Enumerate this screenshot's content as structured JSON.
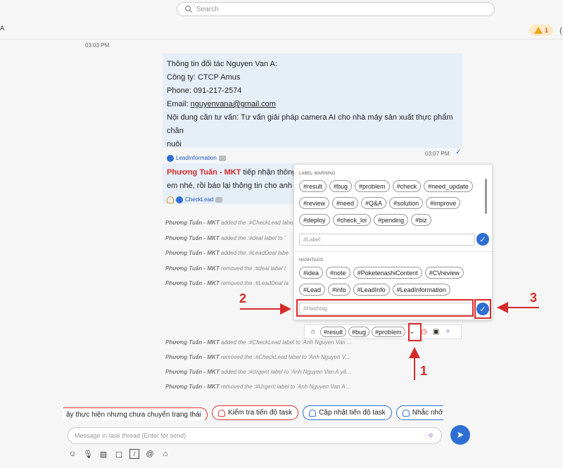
{
  "search": {
    "placeholder": "Search"
  },
  "header": {
    "left_letter": "A",
    "warning_count": "1",
    "right_glyph": "("
  },
  "messages": {
    "time1": "03:03 PM",
    "lead": {
      "line1": "Thông tin đối tác Nguyen Van A:",
      "line2": "Công ty: CTCP Amus",
      "line3": "Phone: 091-217-2574",
      "email_prefix": "Email: ",
      "email": "nguyenvana@gmail.com",
      "line5": "Nội dung cần tư vấn: Tư vấn giải pháp camera AI cho nhà máy sản xuất thực phẩm chăn",
      "line6": "nuôi",
      "tag": "LeadInformation"
    },
    "time2": "03:07 PM",
    "reply": {
      "name": "Phương Tuấn - MKT",
      "text1": " tiếp nhận thông",
      "text2": "em nhé, rồi báo lại thông tin cho anh",
      "tag": "CheckLead"
    },
    "system_top": [
      {
        "actor": "Phương Tuấn - MKT",
        "text": " added the :#CheckLead label to '"
      },
      {
        "actor": "Phương Tuấn - MKT",
        "text": " added the :#deal label to '"
      },
      {
        "actor": "Phương Tuấn - MKT",
        "text": " added the :#LeadDeal labe"
      },
      {
        "actor": "Phương Tuấn - MKT",
        "text": " removed the :#deal label t"
      },
      {
        "actor": "Phương Tuấn - MKT",
        "text": " removed the :#LeadDeal la"
      }
    ],
    "system_bottom": [
      {
        "actor": "Phương Tuấn - MKT",
        "text": " added the :#CheckLead label to 'Anh Nguyen Van ..."
      },
      {
        "actor": "Phương Tuấn - MKT",
        "text": " removed the :#CheckLead label to 'Anh Nguyen V..."
      },
      {
        "actor": "Phương Tuấn - MKT",
        "text": " added the :#Urgent label to 'Anh Nguyen Van A yê..."
      },
      {
        "actor": "Phương Tuấn - MKT",
        "text": " removed the :#Urgent label to 'Anh Nguyen Van A ..."
      }
    ]
  },
  "popup": {
    "label_title": "LABEL WARNING",
    "labels": [
      "#result",
      "#bug",
      "#problem",
      "#check",
      "#need_update",
      "#review",
      "#need",
      "#Q&A",
      "#solution",
      "#improve",
      "#deploy",
      "#check_loi",
      "#pending",
      "#biz"
    ],
    "label_placeholder": "#Label",
    "hashtag_title": "HASHTAGS",
    "hashtags": [
      "#idea",
      "#note",
      "#PoketenashiContent",
      "#CVreview",
      "#Lead",
      "#info",
      "#LeadInfo",
      "#LeadInformation"
    ],
    "hashtag_placeholder": "#Hashtag"
  },
  "toolbar": {
    "chips": [
      "#result",
      "#bug",
      "#problem"
    ]
  },
  "annotations": {
    "n1": "1",
    "n2": "2",
    "n3": "3"
  },
  "quick_actions": [
    "ây thực hiện nhưng chưa chuyển trạng thái",
    "Kiểm tra tiến độ task",
    "Cập nhật tiến độ task",
    "Nhắc nhở task sắp tớ"
  ],
  "composer": {
    "placeholder": "Message in task thread (Enter for send)"
  },
  "colors": {
    "accent": "#2f6fd3",
    "annotation": "#d62b2b",
    "bubble": "#e6eff8"
  }
}
